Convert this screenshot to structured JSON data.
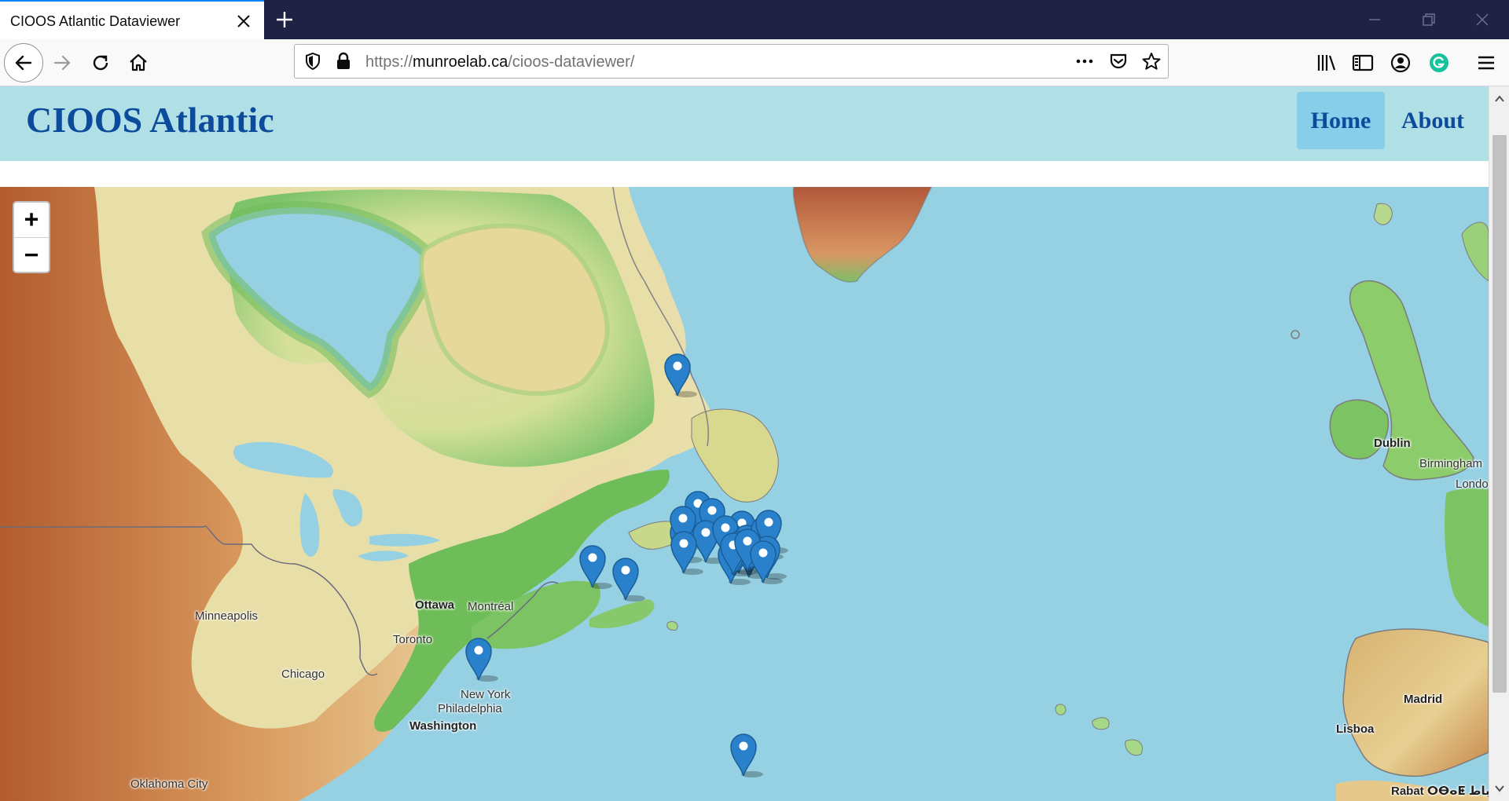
{
  "browser": {
    "tab_title": "CIOOS Atlantic Dataviewer",
    "url_prefix": "https://",
    "url_host": "munroelab.ca",
    "url_path": "/cioos-dataviewer/",
    "toolbar_icons": [
      "back-icon",
      "forward-icon",
      "reload-icon",
      "home-icon",
      "shield-icon",
      "lock-icon",
      "more-icon",
      "pocket-icon",
      "bookmark-star-icon",
      "library-icon",
      "sidebar-icon",
      "account-icon",
      "grammarly-icon",
      "menu-icon"
    ]
  },
  "header": {
    "brand": "CIOOS Atlantic",
    "nav": [
      {
        "label": "Home",
        "active": true
      },
      {
        "label": "About",
        "active": false
      }
    ]
  },
  "map": {
    "zoom_in_label": "+",
    "zoom_out_label": "−",
    "marker_color": "#2a81cb",
    "marker_count": 23,
    "cities": {
      "ottawa": "Ottawa",
      "montreal": "Montréal",
      "toronto": "Toronto",
      "minneapolis": "Minneapolis",
      "chicago": "Chicago",
      "new_york": "New York",
      "philadelphia": "Philadelphia",
      "washington": "Washington",
      "oklahoma_city": "Oklahoma City",
      "dublin": "Dublin",
      "birmingham": "Birmingham",
      "london": "Londo",
      "madrid": "Madrid",
      "lisboa": "Lisboa",
      "rabat": "Rabat ⵔⴱⴰⵟ الرباط"
    }
  }
}
